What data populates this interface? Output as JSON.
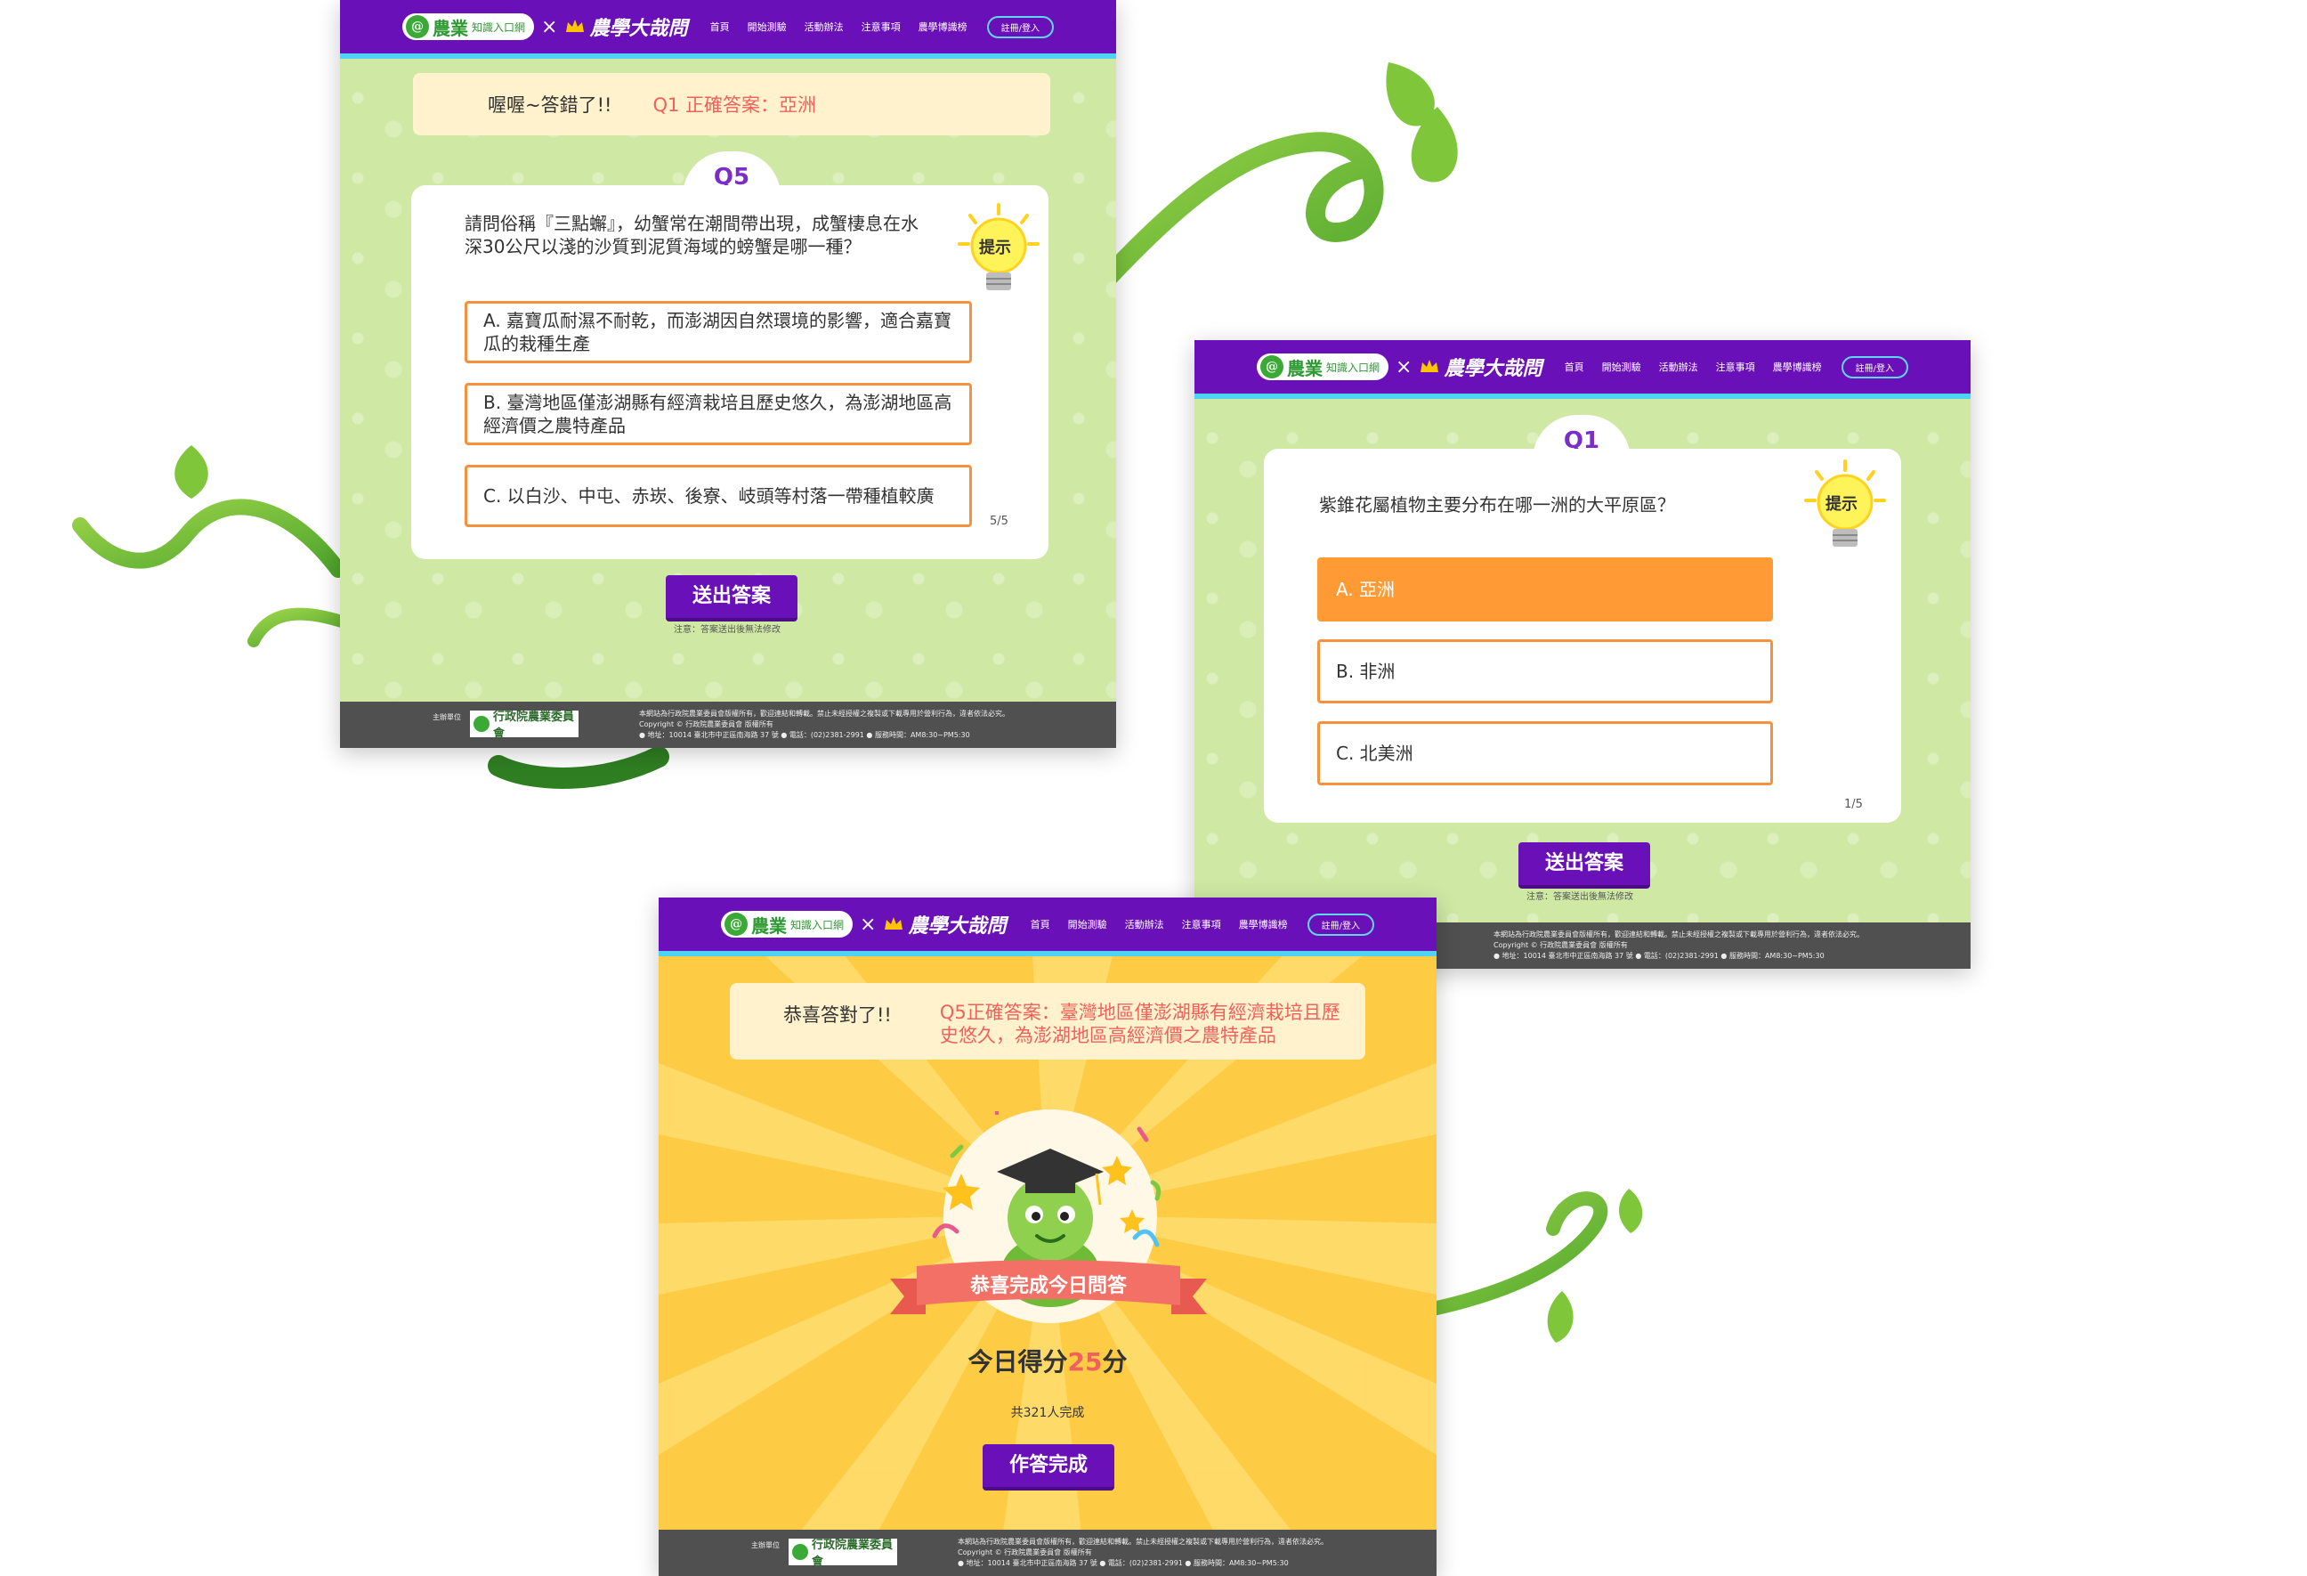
{
  "header": {
    "agri_logo": "農業",
    "agri_logo_sub": "知識入口網",
    "cross": "×",
    "quiz_logo": "農學大哉問",
    "nav": [
      "首頁",
      "開始測驗",
      "活動辦法",
      "注意事項",
      "農學博識榜"
    ],
    "login": "註冊/登入"
  },
  "footer": {
    "sponsor_label": "主辦單位",
    "sponsor_name": "行政院農業委員會",
    "line1": "本網站為行政院農業委員會版權所有，歡迎連結和轉載。禁止未經授權之複製或下載專用於營利行為，違者依法必究。",
    "line2": "Copyright © 行政院農業委員會 版權所有",
    "line3": "● 地址：10014 臺北市中正區南海路 37 號 ● 電話：(02)2381-2991 ● 服務時間：AM8:30~PM5:30"
  },
  "screen_q5": {
    "banner_status": "喔喔~答錯了!!",
    "banner_answer": "Q1 正確答案：亞洲",
    "question_number": "Q5",
    "question": "請問俗稱『三點蠏』，幼蟹常在潮間帶出現，成蟹棲息在水深30公尺以淺的沙質到泥質海域的螃蟹是哪一種？",
    "hint": "提示",
    "options": [
      "A. 嘉寶瓜耐濕不耐乾，而澎湖因自然環境的影響，適合嘉寶瓜的栽種生產",
      "B. 臺灣地區僅澎湖縣有經濟栽培且歷史悠久，為澎湖地區高經濟價之農特產品",
      "C. 以白沙、中屯、赤崁、後寮、岐頭等村落一帶種植較廣"
    ],
    "progress": "5/5",
    "submit": "送出答案",
    "note": "注意：答案送出後無法修改"
  },
  "screen_q1": {
    "question_number": "Q1",
    "question": "紫錐花屬植物主要分布在哪一洲的大平原區？",
    "hint": "提示",
    "options": [
      "A. 亞洲",
      "B. 非洲",
      "C. 北美洲"
    ],
    "selected_option": "A. 亞洲",
    "progress": "1/5",
    "submit": "送出答案",
    "note": "注意：答案送出後無法修改"
  },
  "screen_result": {
    "banner_status": "恭喜答對了!!",
    "banner_answer": "Q5正確答案：臺灣地區僅澎湖縣有經濟栽培且歷史悠久，為澎湖地區高經濟價之農特產品",
    "ribbon": "恭喜完成今日問答",
    "score_prefix": "今日得分",
    "score": "25",
    "score_suffix": "分",
    "completed": "共321人完成",
    "finish": "作答完成"
  },
  "colors": {
    "header_purple": "#6a10b8",
    "header_border": "#4fd3f2",
    "option_border": "#f7913d",
    "selected_option": "#ff9a34",
    "answer_red": "#f0615d",
    "green_background": "#cfe9a4",
    "result_yellow": "#fecb45"
  }
}
